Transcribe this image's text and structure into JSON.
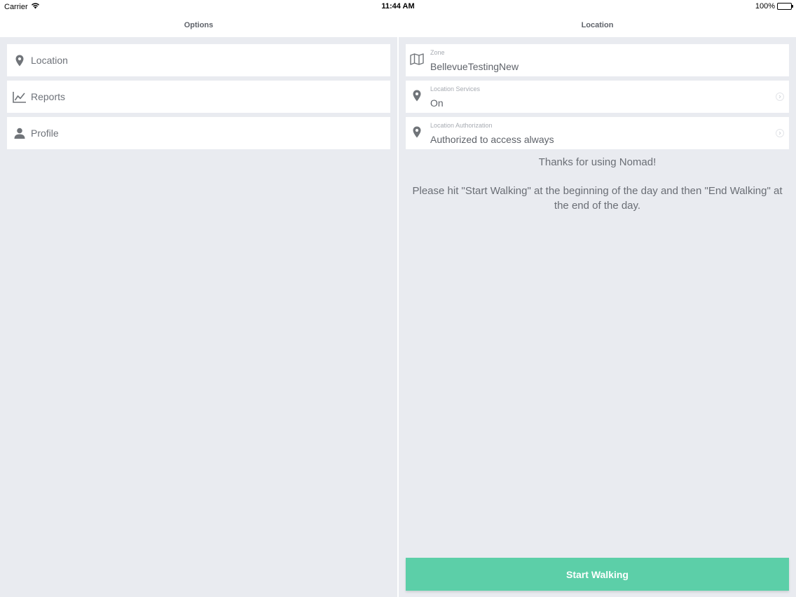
{
  "status_bar": {
    "carrier": "Carrier",
    "time": "11:44 AM",
    "battery": "100%"
  },
  "options_pane": {
    "title": "Options",
    "items": [
      {
        "label": "Location",
        "icon": "location-pin-icon"
      },
      {
        "label": "Reports",
        "icon": "line-chart-icon"
      },
      {
        "label": "Profile",
        "icon": "person-icon"
      }
    ]
  },
  "location_pane": {
    "title": "Location",
    "fields": [
      {
        "caption": "Zone",
        "value": "BellevueTestingNew",
        "icon": "map-icon"
      },
      {
        "caption": "Location Services",
        "value": "On",
        "icon": "location-pin-icon"
      },
      {
        "caption": "Location Authorization",
        "value": "Authorized to access always",
        "icon": "location-pin-icon"
      }
    ],
    "thanks": "Thanks for using Nomad!",
    "instructions": "Please hit \"Start Walking\" at the beginning of the day and then \"End Walking\" at the end of the day.",
    "start_button": "Start Walking"
  },
  "colors": {
    "accent": "#5ccfa8",
    "background": "#e9ebf0",
    "card": "#ffffff",
    "text": "#6e7279"
  }
}
